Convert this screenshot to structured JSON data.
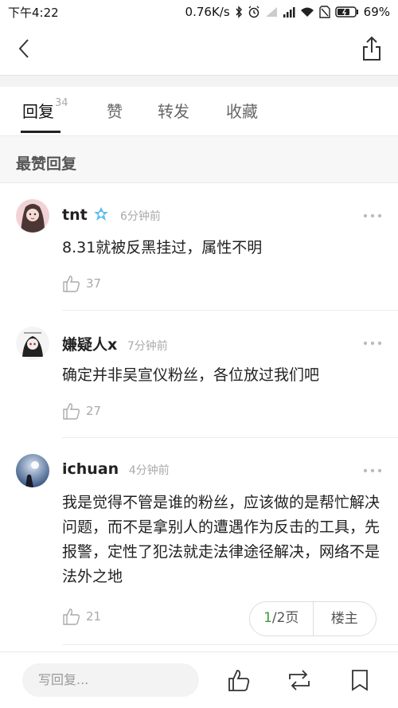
{
  "status": {
    "time": "下午4:22",
    "speed": "0.76K/s",
    "battery": "69%"
  },
  "tabs": [
    {
      "label": "回复",
      "count": "34"
    },
    {
      "label": "赞"
    },
    {
      "label": "转发"
    },
    {
      "label": "收藏"
    }
  ],
  "section_title": "最赞回复",
  "comments": [
    {
      "name": "tnt",
      "time": "6分钟前",
      "text": "8.31就被反黑挂过，属性不明",
      "likes": "37"
    },
    {
      "name": "嫌疑人x",
      "time": "7分钟前",
      "text": "确定并非吴宣仪粉丝，各位放过我们吧",
      "likes": "27"
    },
    {
      "name": "ichuan",
      "time": "4分钟前",
      "text": "我是觉得不管是谁的粉丝，应该做的是帮忙解决问题，而不是拿别人的遭遇作为反击的工具，先报警，定性了犯法就走法律途径解决，网络不是法外之地",
      "likes": "21"
    }
  ],
  "pager": {
    "current": "1",
    "rest": "/2页",
    "floor_owner": "楼主"
  },
  "reply_placeholder": "写回复..."
}
